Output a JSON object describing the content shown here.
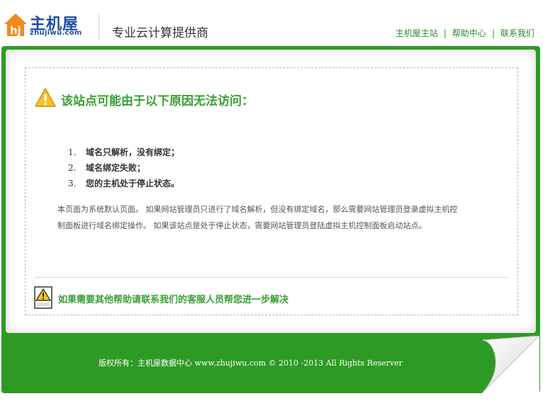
{
  "header": {
    "logo_cn": "主机屋",
    "logo_en": "zhujiwu.com",
    "slogan": "专业云计算提供商",
    "links": [
      "主机屋主站",
      "帮助中心",
      "联系我们"
    ]
  },
  "notice": {
    "title": "该站点可能由于以下原因无法访问：",
    "reasons": [
      {
        "num": "1.",
        "text": "域名只解析，没有绑定；"
      },
      {
        "num": "2.",
        "text": "域名绑定失败；"
      },
      {
        "num": "3.",
        "text": "您的主机处于停止状态。"
      }
    ],
    "description_lines": [
      "本页面为系统默认页面。 如果网站管理员只进行了域名解析，但没有绑定域名，那么需要网站管理员登录虚拟主机控",
      "制面板进行域名绑定操作。 如果该站点是处于停止状态，需要网站管理员登陆虚拟主机控制面板启动站点。"
    ],
    "help_text": "如果需要其他帮助请联系我们的客服人员帮您进一步解决"
  },
  "footer": {
    "copyright_prefix": "版权所有：主机屋数据中心",
    "copyright_suffix": "www.zhujiwu.com © 2010 -2013 All Rights Reserver"
  },
  "colors": {
    "brand_blue": "#1b4f9c",
    "brand_orange": "#f08a1c",
    "green_frame": "#2d9b23",
    "green_text": "#38a035",
    "warning_yellow": "#f7c21e"
  }
}
